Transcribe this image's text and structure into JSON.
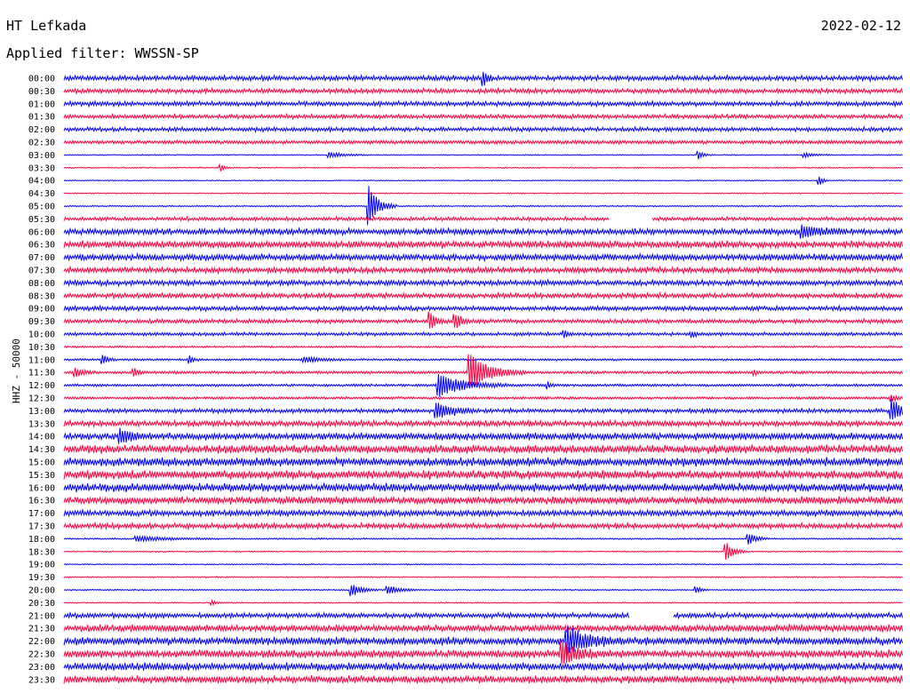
{
  "header": {
    "station": "HT Lefkada",
    "date": "2022-02-12",
    "filter_label": "Applied filter: WWSSN-SP"
  },
  "channel_label": "HHZ - 50000",
  "colors": {
    "even_rows": "#0000ff",
    "odd_rows": "#ff0040"
  },
  "chart_data": {
    "type": "helicorder",
    "title": "HT Lefkada",
    "date": "2022-02-12",
    "filter": "WWSSN-SP",
    "ylabel": "HHZ - 50000",
    "row_labels": [
      "00:00",
      "00:30",
      "01:00",
      "01:30",
      "02:00",
      "02:30",
      "03:00",
      "03:30",
      "04:00",
      "04:30",
      "05:00",
      "05:30",
      "06:00",
      "06:30",
      "07:00",
      "07:30",
      "08:00",
      "08:30",
      "09:00",
      "09:30",
      "10:00",
      "10:30",
      "11:00",
      "11:30",
      "12:00",
      "12:30",
      "13:00",
      "13:30",
      "14:00",
      "14:30",
      "15:00",
      "15:30",
      "16:00",
      "16:30",
      "17:00",
      "17:30",
      "18:00",
      "18:30",
      "19:00",
      "19:30",
      "20:00",
      "20:30",
      "21:00",
      "21:30",
      "22:00",
      "22:30",
      "23:00",
      "23:30"
    ],
    "noise_level": [
      0.55,
      0.5,
      0.5,
      0.45,
      0.45,
      0.3,
      0.02,
      0.04,
      0.03,
      0.03,
      0.06,
      0.4,
      0.7,
      0.8,
      0.75,
      0.65,
      0.6,
      0.55,
      0.5,
      0.45,
      0.35,
      0.12,
      0.15,
      0.22,
      0.2,
      0.2,
      0.45,
      0.65,
      0.8,
      0.95,
      1.0,
      1.0,
      0.95,
      0.85,
      0.7,
      0.6,
      0.08,
      0.04,
      0.04,
      0.05,
      0.05,
      0.04,
      0.55,
      0.8,
      0.9,
      0.9,
      0.9,
      0.85
    ],
    "events": [
      {
        "row": 0,
        "minute": 15.0,
        "amplitude": 1.6,
        "duration_min": 0.4
      },
      {
        "row": 6,
        "minute": 9.5,
        "amplitude": 0.6,
        "duration_min": 1.5
      },
      {
        "row": 6,
        "minute": 22.7,
        "amplitude": 1.0,
        "duration_min": 0.5
      },
      {
        "row": 6,
        "minute": 26.5,
        "amplitude": 0.5,
        "duration_min": 1.0
      },
      {
        "row": 7,
        "minute": 5.6,
        "amplitude": 0.8,
        "duration_min": 0.4
      },
      {
        "row": 8,
        "minute": 27.0,
        "amplitude": 1.2,
        "duration_min": 0.4
      },
      {
        "row": 10,
        "minute": 10.9,
        "amplitude": 4.5,
        "duration_min": 1.0
      },
      {
        "row": 12,
        "minute": 26.4,
        "amplitude": 1.5,
        "duration_min": 1.5
      },
      {
        "row": 19,
        "minute": 13.1,
        "amplitude": 1.8,
        "duration_min": 0.6
      },
      {
        "row": 19,
        "minute": 14.0,
        "amplitude": 1.8,
        "duration_min": 0.6
      },
      {
        "row": 20,
        "minute": 17.9,
        "amplitude": 0.8,
        "duration_min": 0.3
      },
      {
        "row": 20,
        "minute": 22.5,
        "amplitude": 0.6,
        "duration_min": 0.3
      },
      {
        "row": 22,
        "minute": 1.4,
        "amplitude": 1.0,
        "duration_min": 0.5
      },
      {
        "row": 22,
        "minute": 8.6,
        "amplitude": 0.6,
        "duration_min": 1.5
      },
      {
        "row": 22,
        "minute": 4.5,
        "amplitude": 0.8,
        "duration_min": 0.4
      },
      {
        "row": 23,
        "minute": 0.4,
        "amplitude": 1.1,
        "duration_min": 0.7
      },
      {
        "row": 23,
        "minute": 2.5,
        "amplitude": 1.0,
        "duration_min": 0.4
      },
      {
        "row": 23,
        "minute": 14.5,
        "amplitude": 4.0,
        "duration_min": 2.0
      },
      {
        "row": 23,
        "minute": 24.7,
        "amplitude": 0.6,
        "duration_min": 0.3
      },
      {
        "row": 24,
        "minute": 13.4,
        "amplitude": 2.5,
        "duration_min": 2.5
      },
      {
        "row": 24,
        "minute": 17.3,
        "amplitude": 0.8,
        "duration_min": 0.3
      },
      {
        "row": 25,
        "minute": 29.6,
        "amplitude": 0.8,
        "duration_min": 0.5
      },
      {
        "row": 26,
        "minute": 13.3,
        "amplitude": 2.0,
        "duration_min": 1.5
      },
      {
        "row": 26,
        "minute": 29.6,
        "amplitude": 2.5,
        "duration_min": 1.0
      },
      {
        "row": 28,
        "minute": 2.0,
        "amplitude": 1.6,
        "duration_min": 1.0
      },
      {
        "row": 36,
        "minute": 2.6,
        "amplitude": 0.6,
        "duration_min": 3.0
      },
      {
        "row": 36,
        "minute": 24.5,
        "amplitude": 1.2,
        "duration_min": 0.8
      },
      {
        "row": 37,
        "minute": 23.7,
        "amplitude": 2.0,
        "duration_min": 0.8
      },
      {
        "row": 40,
        "minute": 10.3,
        "amplitude": 1.4,
        "duration_min": 1.0
      },
      {
        "row": 40,
        "minute": 11.6,
        "amplitude": 1.0,
        "duration_min": 1.2
      },
      {
        "row": 40,
        "minute": 22.6,
        "amplitude": 0.8,
        "duration_min": 0.5
      },
      {
        "row": 41,
        "minute": 5.3,
        "amplitude": 0.6,
        "duration_min": 0.4
      },
      {
        "row": 44,
        "minute": 18.0,
        "amplitude": 3.0,
        "duration_min": 2.0
      },
      {
        "row": 45,
        "minute": 17.8,
        "amplitude": 2.5,
        "duration_min": 1.5
      }
    ],
    "gaps": [
      {
        "row": 11,
        "from_min": 19.5,
        "to_min": 21.0
      },
      {
        "row": 42,
        "from_min": 20.2,
        "to_min": 21.8
      }
    ],
    "x_range_minutes": [
      0,
      30
    ]
  }
}
